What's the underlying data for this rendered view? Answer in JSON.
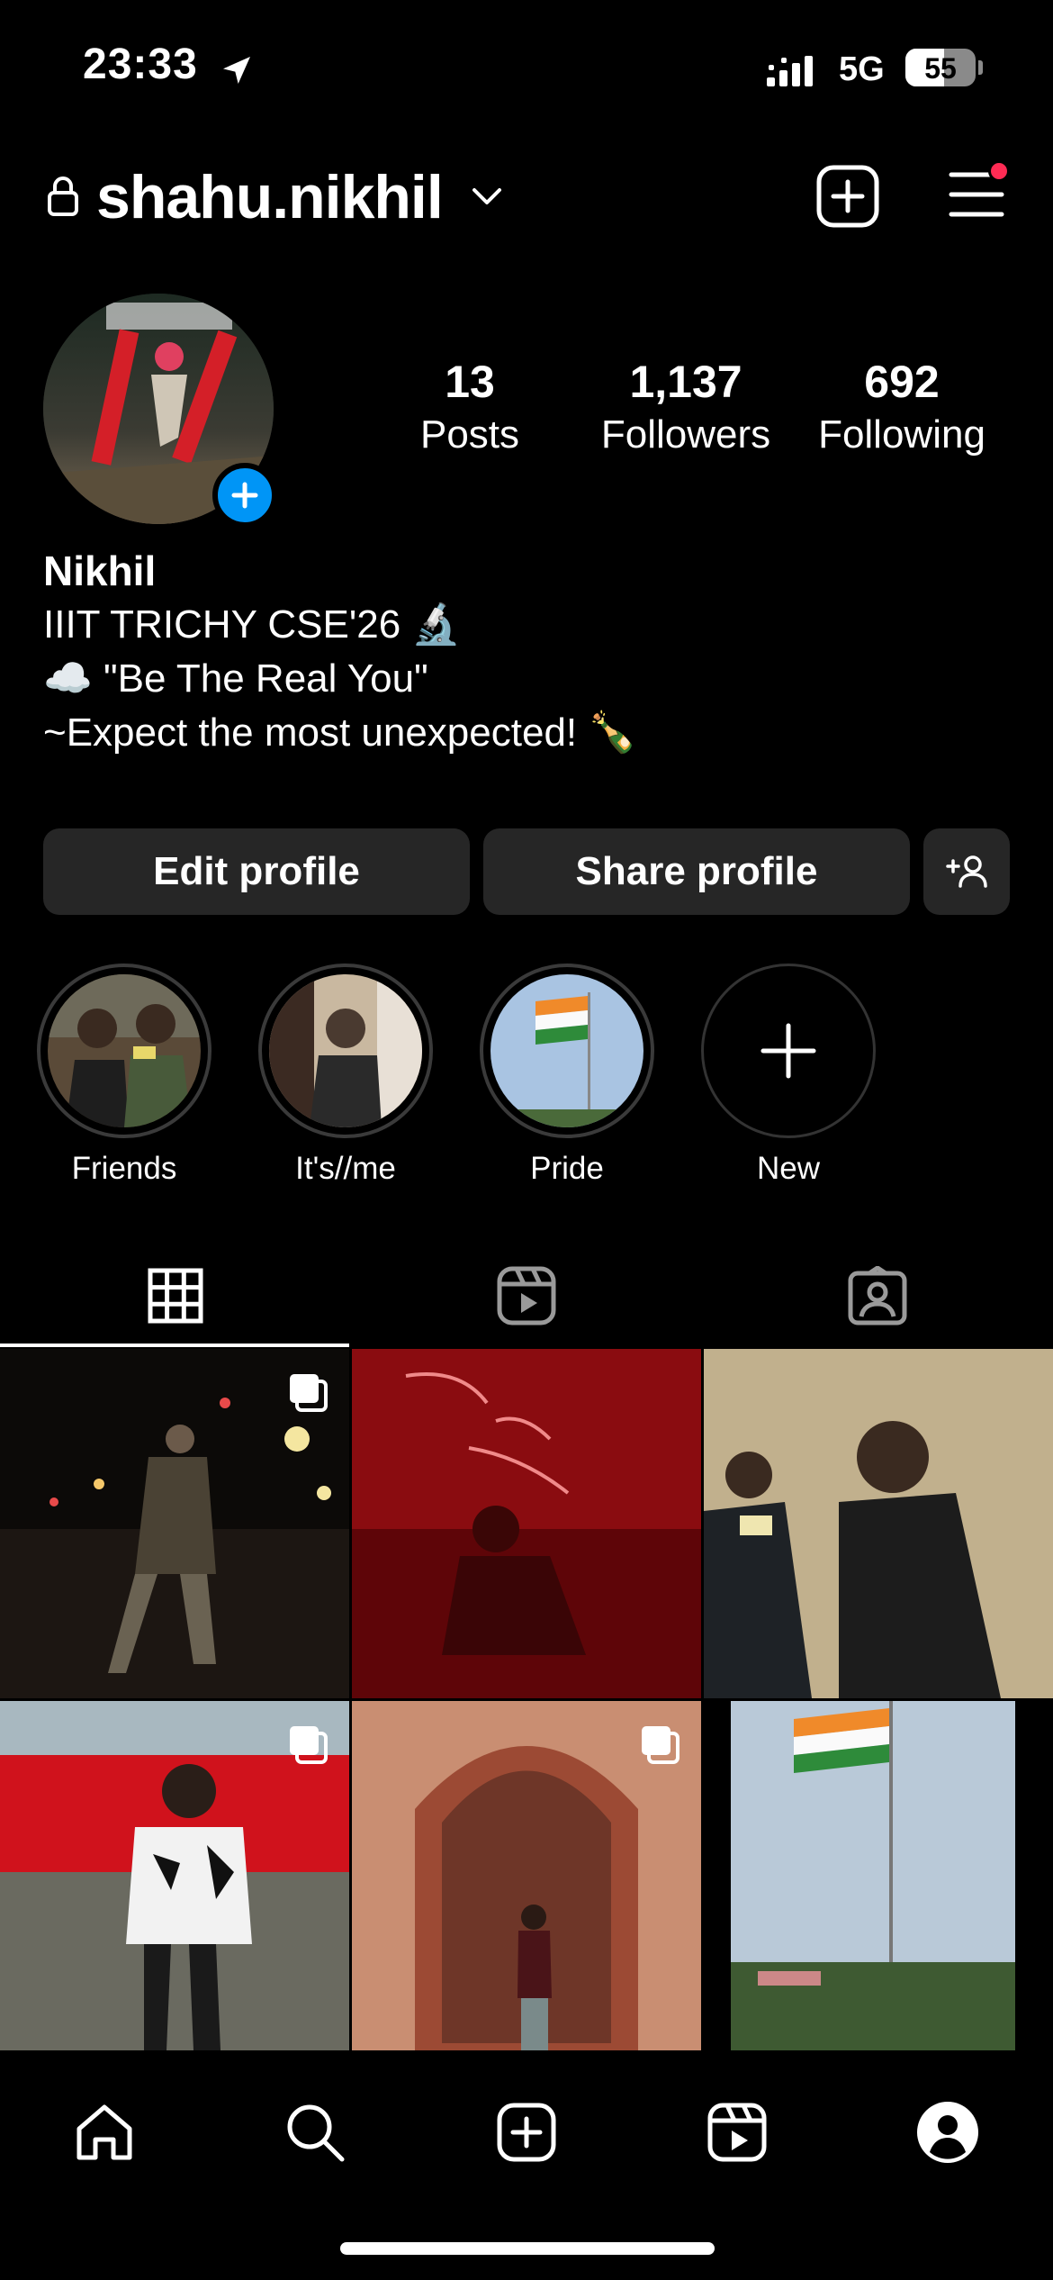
{
  "status_bar": {
    "time": "23:33",
    "network": "5G",
    "battery_percent": "55",
    "battery_level": 0.55
  },
  "header": {
    "username": "shahu.nikhil",
    "notification_dot_color": "#ff2b54"
  },
  "profile": {
    "stats": [
      {
        "value": "13",
        "label": "Posts"
      },
      {
        "value": "1,137",
        "label": "Followers"
      },
      {
        "value": "692",
        "label": "Following"
      }
    ],
    "name": "Nikhil",
    "bio": [
      "IIIT TRICHY CSE'26 🔬",
      "☁️ \"Be The Real You\"",
      "~Expect the most unexpected! 🍾"
    ]
  },
  "actions": {
    "edit_label": "Edit profile",
    "share_label": "Share profile",
    "suggest_icon": "add-person-icon"
  },
  "highlights": [
    {
      "label": "Friends"
    },
    {
      "label": "It's//me"
    },
    {
      "label": "Pride"
    },
    {
      "label": "New"
    }
  ],
  "tabs": [
    "grid-icon",
    "reels-icon",
    "tagged-icon"
  ],
  "nav": [
    "home-icon",
    "search-icon",
    "create-icon",
    "reels-icon",
    "profile-icon"
  ],
  "colors": {
    "accent": "#0095f6",
    "button_bg": "#262626"
  }
}
